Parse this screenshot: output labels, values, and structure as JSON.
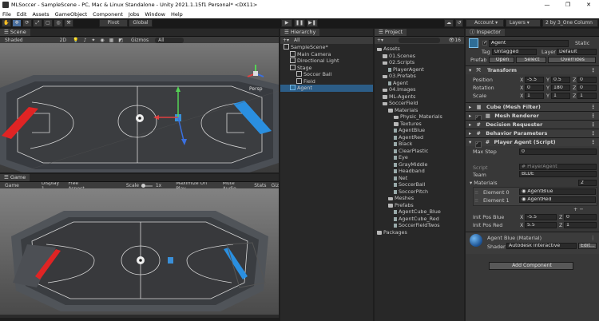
{
  "window": {
    "title": "MLSoccer - SampleScene - PC, Mac & Linux Standalone - Unity 2021.1.15f1 Personal* <DX11>",
    "buttons": [
      "—",
      "❐",
      "✕"
    ]
  },
  "menu": [
    "File",
    "Edit",
    "Assets",
    "GameObject",
    "Component",
    "Jobs",
    "Window",
    "Help"
  ],
  "toolbar": {
    "pivot": "Pivot",
    "global": "Global",
    "account": "Account",
    "layers": "Layers",
    "layout": "2 by 3_One Column"
  },
  "scene": {
    "tab": "Scene",
    "shading": "Shaded",
    "mode2d": "2D",
    "gizmos": "Gizmos",
    "search": "All",
    "persp": "Persp"
  },
  "game": {
    "tab": "Game",
    "display": "Game",
    "display_num": "Display 1",
    "aspect": "Free Aspect",
    "scale_label": "Scale",
    "scale_value": "1x",
    "maximize": "Maximize On Play",
    "mute": "Mute Audio",
    "stats": "Stats",
    "gizmos": "Giz"
  },
  "hierarchy": {
    "tab": "Hierarchy",
    "search": "All",
    "items": [
      {
        "label": "SampleScene*",
        "indent": 0
      },
      {
        "label": "Main Camera",
        "indent": 1
      },
      {
        "label": "Directional Light",
        "indent": 1
      },
      {
        "label": "Stage",
        "indent": 1
      },
      {
        "label": "Soccer Ball",
        "indent": 2
      },
      {
        "label": "Field",
        "indent": 2
      },
      {
        "label": "Agent",
        "indent": 1
      }
    ]
  },
  "project": {
    "tab": "Project",
    "count": "16",
    "items": [
      {
        "label": "Assets",
        "indent": 0,
        "kind": "folder"
      },
      {
        "label": "01.Scenes",
        "indent": 1,
        "kind": "folder"
      },
      {
        "label": "02.Scripts",
        "indent": 1,
        "kind": "folder"
      },
      {
        "label": "PlayerAgent",
        "indent": 2,
        "kind": "file"
      },
      {
        "label": "03.Prefabs",
        "indent": 1,
        "kind": "folder"
      },
      {
        "label": "Agent",
        "indent": 2,
        "kind": "file"
      },
      {
        "label": "04.Images",
        "indent": 1,
        "kind": "folder"
      },
      {
        "label": "ML-Agents",
        "indent": 1,
        "kind": "folder"
      },
      {
        "label": "SoccerField",
        "indent": 1,
        "kind": "folder"
      },
      {
        "label": "Materials",
        "indent": 2,
        "kind": "folder"
      },
      {
        "label": "Physic_Materials",
        "indent": 3,
        "kind": "folder"
      },
      {
        "label": "Textures",
        "indent": 3,
        "kind": "folder"
      },
      {
        "label": "AgentBlue",
        "indent": 3,
        "kind": "file"
      },
      {
        "label": "AgentRed",
        "indent": 3,
        "kind": "file"
      },
      {
        "label": "Black",
        "indent": 3,
        "kind": "file"
      },
      {
        "label": "ClearPlastic",
        "indent": 3,
        "kind": "file"
      },
      {
        "label": "Eye",
        "indent": 3,
        "kind": "file"
      },
      {
        "label": "GrayMiddle",
        "indent": 3,
        "kind": "file"
      },
      {
        "label": "Headband",
        "indent": 3,
        "kind": "file"
      },
      {
        "label": "Net",
        "indent": 3,
        "kind": "file"
      },
      {
        "label": "SoccerBall",
        "indent": 3,
        "kind": "file"
      },
      {
        "label": "SoccerPitch",
        "indent": 3,
        "kind": "file"
      },
      {
        "label": "Meshes",
        "indent": 2,
        "kind": "folder"
      },
      {
        "label": "Prefabs",
        "indent": 2,
        "kind": "folder"
      },
      {
        "label": "AgentCube_Blue",
        "indent": 3,
        "kind": "file"
      },
      {
        "label": "AgentCube_Red",
        "indent": 3,
        "kind": "file"
      },
      {
        "label": "SoccerFieldTwos",
        "indent": 3,
        "kind": "file"
      },
      {
        "label": "Packages",
        "indent": 0,
        "kind": "folder"
      }
    ]
  },
  "inspector": {
    "tab": "Inspector",
    "name": "Agent",
    "static": "Static",
    "tag_label": "Tag",
    "tag": "Untagged",
    "layer_label": "Layer",
    "layer": "Default",
    "prefab_label": "Prefab",
    "open": "Open",
    "select": "Select",
    "overrides": "Overrides",
    "transform": {
      "title": "Transform",
      "position": {
        "label": "Position",
        "x": "-5.5",
        "y": "0.5",
        "z": "0"
      },
      "rotation": {
        "label": "Rotation",
        "x": "0",
        "y": "180",
        "z": "0"
      },
      "scale": {
        "label": "Scale",
        "x": "1",
        "y": "1",
        "z": "1"
      }
    },
    "components": [
      "Cube (Mesh Filter)",
      "Mesh Renderer",
      "Decision Requester",
      "Behavior Parameters",
      "Player Agent (Script)"
    ],
    "max_step_label": "Max Step",
    "max_step": "0",
    "script_label": "Script",
    "script": "PlayerAgent",
    "team_label": "Team",
    "team": "BLUE",
    "materials_label": "Materials",
    "materials_count": "2",
    "element0_label": "Element 0",
    "element0": "AgentBlue",
    "element1_label": "Element 1",
    "element1": "AgentRed",
    "plus_minus": "+  −",
    "init_blue": {
      "label": "Init Pos Blue",
      "x": "-5.5",
      "z": "0"
    },
    "init_red": {
      "label": "Init Pos Red",
      "x": "5.5",
      "z": "1"
    },
    "material": {
      "title": "Agent Blue (Material)",
      "shader_label": "Shader",
      "shader": "Autodesk Interactive",
      "edit": "Edit..."
    },
    "add_component": "Add Component"
  },
  "colors": {
    "accent": "#2c5d87",
    "red_goal": "#e02424",
    "blue_goal": "#2a8fe0"
  }
}
